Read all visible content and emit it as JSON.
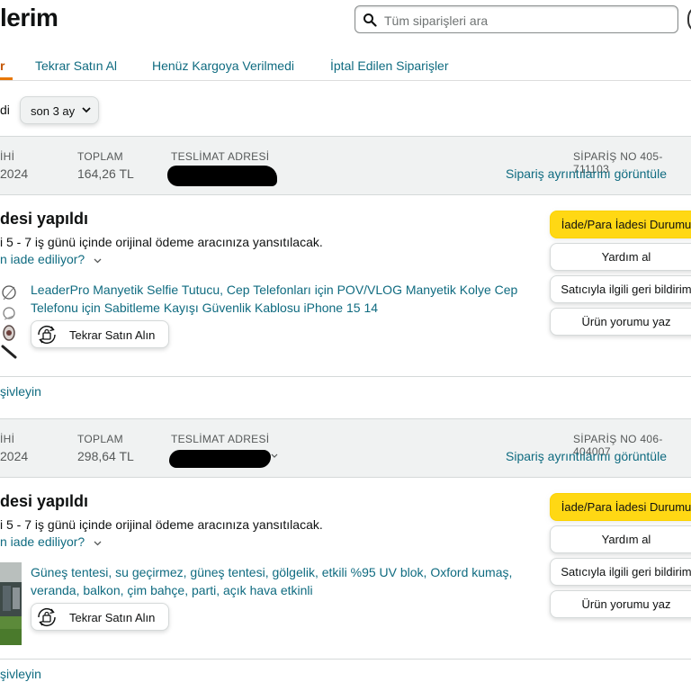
{
  "page": {
    "title": "lerim"
  },
  "search": {
    "placeholder": "Tüm siparişleri ara",
    "icon": "search-icon"
  },
  "tabs": {
    "active": "r",
    "items": [
      "Tekrar Satın Al",
      "Henüz Kargoya Verilmedi",
      "İptal Edilen Siparişler"
    ]
  },
  "filter": {
    "prefix": "di",
    "selected": "son 3 ay"
  },
  "colors": {
    "link": "#0f6b80",
    "primary_button": "#ffd814",
    "header_bg": "#f0f2f2",
    "active_tab": "#c45500"
  },
  "orders": [
    {
      "header": {
        "date_label": "İHİ",
        "date_value": "2024",
        "total_label": "TOPLAM",
        "total_value": "164,26 TL",
        "address_label": "TESLİMAT ADRESİ",
        "order_no_label": "SİPARİŞ NO 405-711103",
        "details_link": "Sipariş ayrıntılarını görüntüle"
      },
      "status": "desi yapıldı",
      "refund_text": "i 5 - 7 iş günü içinde orijinal ödeme aracınıza yansıtılacak.",
      "refund_link": "n iade ediliyor?",
      "product_title": "LeaderPro Manyetik Selfie Tutucu, Cep Telefonları için POV/VLOG Manyetik Kolye Cep Telefonu için Sabitleme Kayışı Güvenlik Kablosu iPhone 15 14",
      "buy_again": "Tekrar Satın Alın",
      "actions": [
        "İade/Para İadesi Durumu",
        "Yardım al",
        "Satıcıyla ilgili geri bildirim",
        "Ürün yorumu yaz"
      ],
      "archive": "şivleyin"
    },
    {
      "header": {
        "date_label": "İHİ",
        "date_value": "2024",
        "total_label": "TOPLAM",
        "total_value": "298,64 TL",
        "address_label": "TESLİMAT ADRESİ",
        "order_no_label": "SİPARİŞ NO 406-404007",
        "details_link": "Sipariş ayrıntılarını görüntüle"
      },
      "status": "desi yapıldı",
      "refund_text": "i 5 - 7 iş günü içinde orijinal ödeme aracınıza yansıtılacak.",
      "refund_link": "n iade ediliyor?",
      "product_title": "Güneş tentesi, su geçirmez, güneş tentesi, gölgelik, etkili %95 UV blok, Oxford kumaş, veranda, balkon, çim bahçe, parti, açık hava etkinli",
      "buy_again": "Tekrar Satın Alın",
      "actions": [
        "İade/Para İadesi Durumu",
        "Yardım al",
        "Satıcıyla ilgili geri bildirim",
        "Ürün yorumu yaz"
      ],
      "archive": "şivleyin"
    }
  ]
}
